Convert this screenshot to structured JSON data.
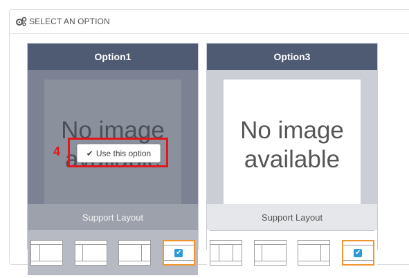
{
  "panel": {
    "title": "SELECT AN OPTION",
    "icon": "gears-icon"
  },
  "cards": [
    {
      "title": "Option1",
      "no_image_line1": "No image",
      "no_image_line2": "available",
      "support": "Support Layout"
    },
    {
      "title": "Option3",
      "no_image_line1": "No image",
      "no_image_line2": "available",
      "support": "Support Layout"
    }
  ],
  "use_button": {
    "label": "Use this option",
    "icon": "check-icon"
  },
  "annotation": {
    "step": "4",
    "color": "#e3161b"
  },
  "colors": {
    "header": "#4e5b73",
    "selected_border": "#f0952d",
    "check_bg": "#2e9ad9"
  }
}
